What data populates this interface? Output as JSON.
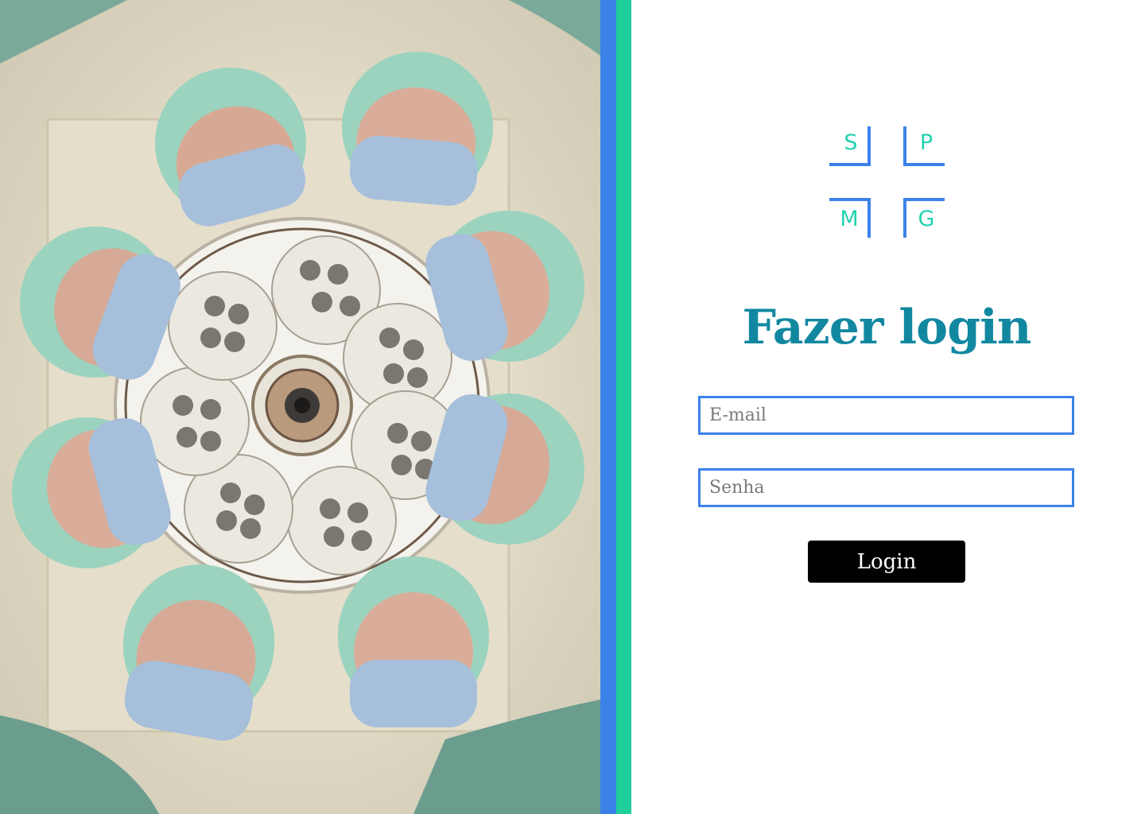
{
  "colors": {
    "accent_blue": "#3b82e8",
    "accent_green": "#1fce9a",
    "logo_letter": "#22d3b0",
    "title": "#1188a0",
    "button_bg": "#000000",
    "button_text": "#ffffff"
  },
  "hero": {
    "image_alt": "Surgical team wearing masks and caps looking down under an operating lamp"
  },
  "logo": {
    "letters": [
      "S",
      "P",
      "M",
      "G"
    ]
  },
  "login": {
    "title": "Fazer login",
    "email_placeholder": "E-mail",
    "password_placeholder": "Senha",
    "button_label": "Login"
  }
}
